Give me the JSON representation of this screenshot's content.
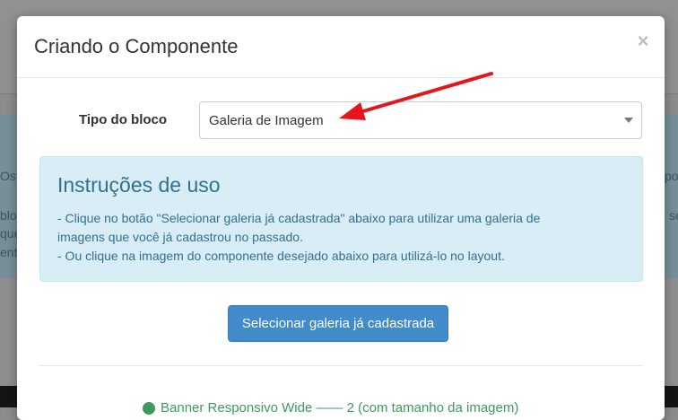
{
  "background": {
    "left_fragments": [
      "Os",
      "blo",
      "que",
      "ent"
    ],
    "right_fragments": [
      "po",
      "se"
    ]
  },
  "modal": {
    "title": "Criando o Componente",
    "close_label": "×"
  },
  "form": {
    "block_type_label": "Tipo do bloco",
    "block_type_value": "Galeria de Imagem"
  },
  "instructions": {
    "title": "Instruções de uso",
    "lines": [
      "- Clique no botão \"Selecionar galeria já cadastrada\" abaixo para utilizar uma galeria de",
      "imagens que você já cadastrou no passado.",
      "- Ou clique na imagem do componente desejado abaixo para utilizá-lo no layout."
    ]
  },
  "actions": {
    "select_gallery_label": "Selecionar galeria já cadastrada"
  },
  "footer": {
    "partial_link_text": "Banner Responsivo Wide —— 2 (com tamanho da imagem)"
  },
  "colors": {
    "annotation_arrow": "#e8141c",
    "primary": "#428bca",
    "alert_bg": "#d9edf7",
    "alert_text": "#31708f"
  }
}
